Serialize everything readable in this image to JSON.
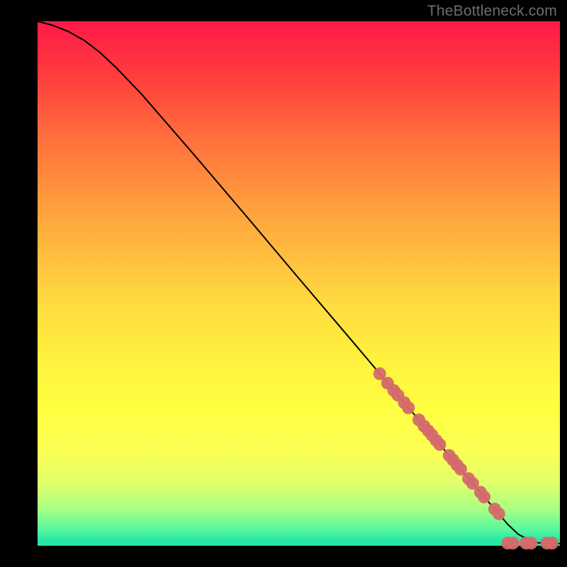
{
  "watermark": "TheBottleneck.com",
  "colors": {
    "background": "#000000",
    "curve": "#000000",
    "marker_fill": "#d46a6a",
    "marker_stroke": "#d46a6a"
  },
  "chart_data": {
    "type": "line",
    "title": "",
    "xlabel": "",
    "ylabel": "",
    "xlim": [
      0,
      100
    ],
    "ylim": [
      0,
      100
    ],
    "grid": false,
    "legend": false,
    "series": [
      {
        "name": "curve",
        "x": [
          0,
          3,
          6,
          9,
          12,
          15,
          20,
          30,
          40,
          50,
          60,
          70,
          80,
          85,
          88,
          90,
          92,
          95,
          100
        ],
        "y": [
          100,
          99.2,
          98.0,
          96.3,
          94.0,
          91.2,
          86.0,
          74.5,
          62.8,
          51.0,
          39.3,
          27.5,
          15.8,
          9.9,
          6.4,
          4.1,
          2.2,
          0.6,
          0.4
        ]
      }
    ],
    "markers": [
      {
        "x": 65.5,
        "y": 32.8
      },
      {
        "x": 67.0,
        "y": 31.0
      },
      {
        "x": 68.2,
        "y": 29.6
      },
      {
        "x": 69.0,
        "y": 28.7
      },
      {
        "x": 70.2,
        "y": 27.3
      },
      {
        "x": 71.0,
        "y": 26.3
      },
      {
        "x": 73.0,
        "y": 24.0
      },
      {
        "x": 74.0,
        "y": 22.8
      },
      {
        "x": 74.8,
        "y": 21.9
      },
      {
        "x": 75.5,
        "y": 21.1
      },
      {
        "x": 76.3,
        "y": 20.1
      },
      {
        "x": 77.0,
        "y": 19.3
      },
      {
        "x": 78.8,
        "y": 17.2
      },
      {
        "x": 79.5,
        "y": 16.4
      },
      {
        "x": 80.3,
        "y": 15.4
      },
      {
        "x": 81.0,
        "y": 14.6
      },
      {
        "x": 82.5,
        "y": 12.8
      },
      {
        "x": 83.3,
        "y": 11.9
      },
      {
        "x": 84.8,
        "y": 10.2
      },
      {
        "x": 85.5,
        "y": 9.3
      },
      {
        "x": 87.5,
        "y": 7.0
      },
      {
        "x": 88.3,
        "y": 6.1
      },
      {
        "x": 90.0,
        "y": 0.5
      },
      {
        "x": 91.0,
        "y": 0.5
      },
      {
        "x": 93.5,
        "y": 0.5
      },
      {
        "x": 94.5,
        "y": 0.5
      },
      {
        "x": 97.5,
        "y": 0.5
      },
      {
        "x": 98.5,
        "y": 0.5
      }
    ]
  }
}
